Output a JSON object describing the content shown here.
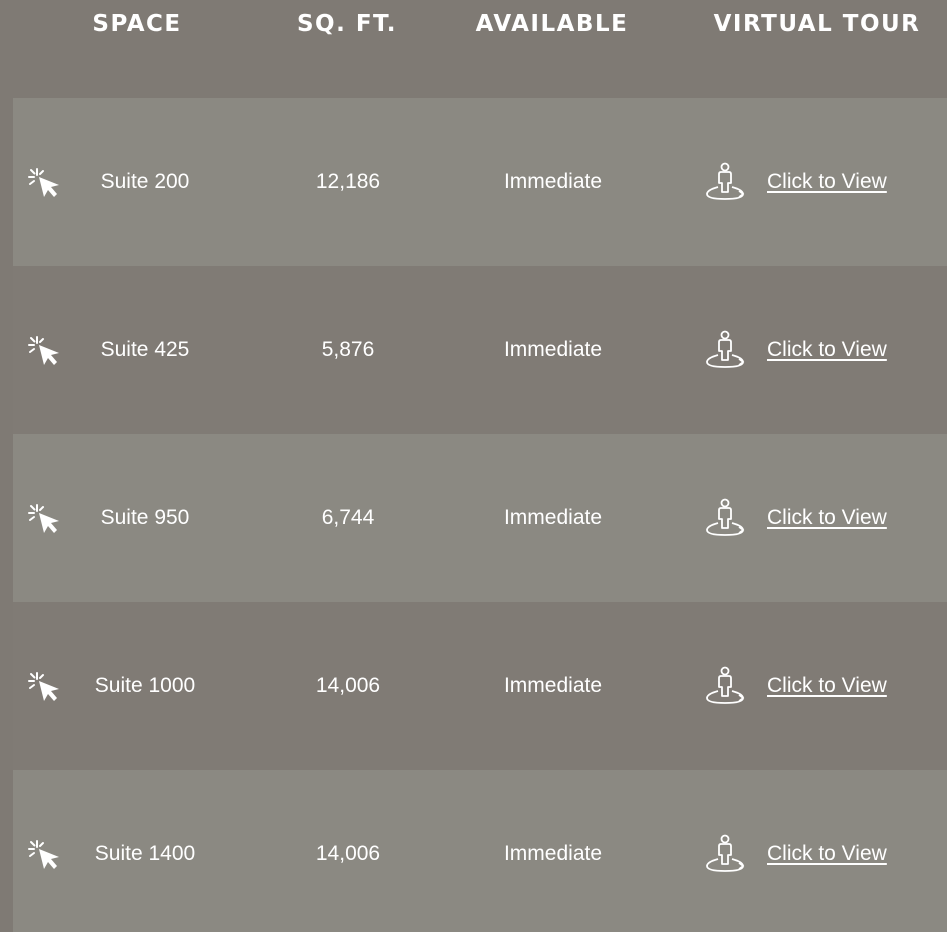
{
  "table": {
    "headers": {
      "space": "SPACE",
      "sqft": "SQ. FT.",
      "available": "AVAILABLE",
      "virtual_tour": "VIRTUAL TOUR"
    },
    "rows": [
      {
        "space": "Suite 200",
        "sqft": "12,186",
        "available": "Immediate",
        "tour_link": "Click to View"
      },
      {
        "space": "Suite 425",
        "sqft": "5,876",
        "available": "Immediate",
        "tour_link": "Click to View"
      },
      {
        "space": "Suite 950",
        "sqft": "6,744",
        "available": "Immediate",
        "tour_link": "Click to View"
      },
      {
        "space": "Suite 1000",
        "sqft": "14,006",
        "available": "Immediate",
        "tour_link": "Click to View"
      },
      {
        "space": "Suite 1400",
        "sqft": "14,006",
        "available": "Immediate",
        "tour_link": "Click to View"
      }
    ]
  },
  "icons": {
    "space": "cursor-click-icon",
    "tour": "person-360-icon"
  },
  "colors": {
    "background": "#7f7a74",
    "row_light": "#8b8982",
    "row_dark": "#807b75",
    "text": "#ffffff"
  }
}
